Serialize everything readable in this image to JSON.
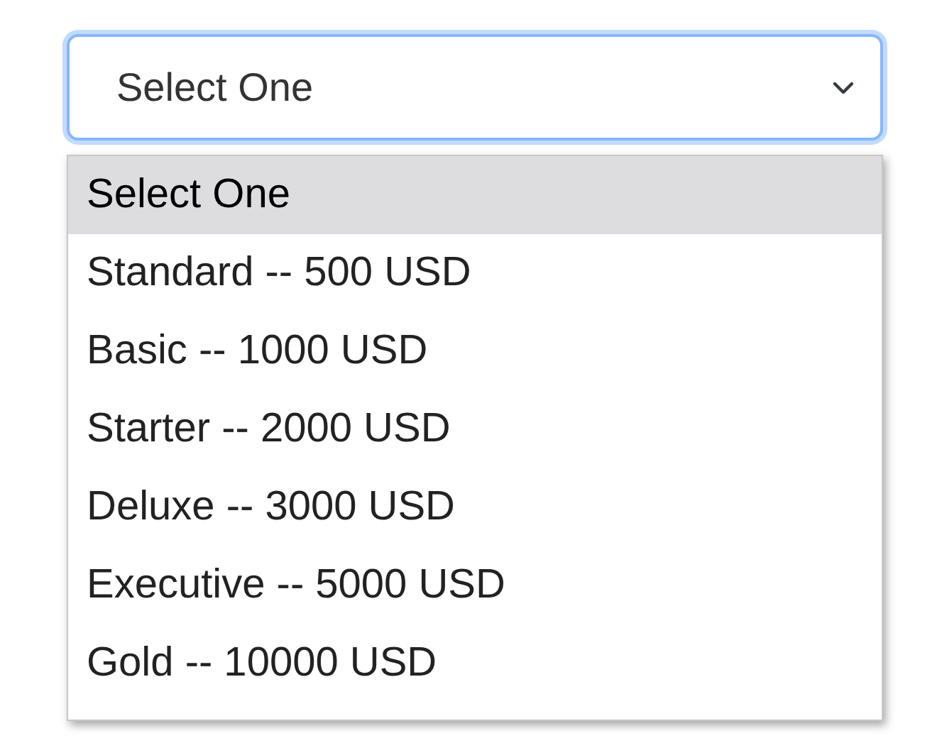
{
  "select": {
    "value": "Select One",
    "focused": true
  },
  "options": [
    {
      "label": "Select One",
      "selected": true
    },
    {
      "label": "Standard -- 500 USD",
      "selected": false
    },
    {
      "label": "Basic -- 1000 USD",
      "selected": false
    },
    {
      "label": "Starter -- 2000 USD",
      "selected": false
    },
    {
      "label": "Deluxe -- 3000 USD",
      "selected": false
    },
    {
      "label": "Executive -- 5000 USD",
      "selected": false
    },
    {
      "label": "Gold -- 10000 USD",
      "selected": false
    }
  ]
}
